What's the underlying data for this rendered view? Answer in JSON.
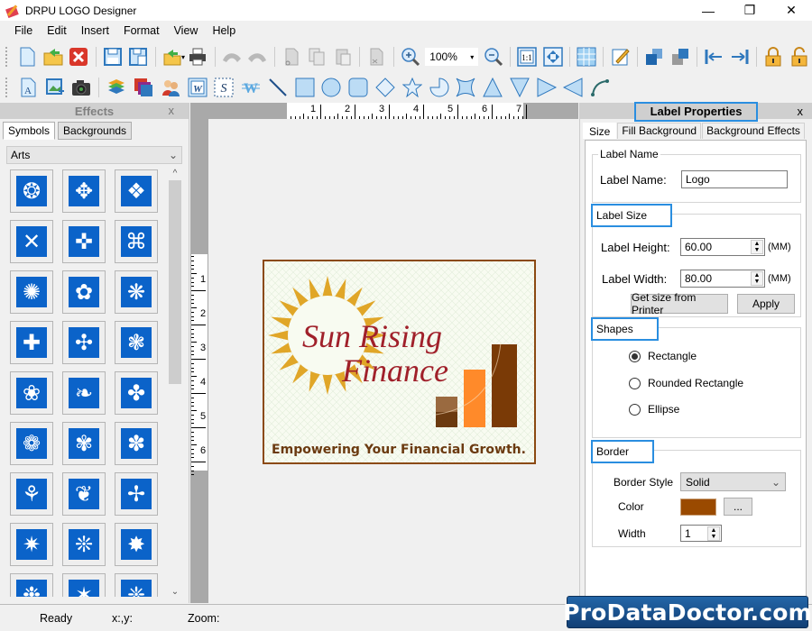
{
  "window": {
    "title": "DRPU LOGO Designer",
    "minimize": "—",
    "restore": "❐",
    "close": "✕"
  },
  "menu": [
    "File",
    "Edit",
    "Insert",
    "Format",
    "View",
    "Help"
  ],
  "toolbar": {
    "zoom_value": "100%",
    "zoom_dropdown": "▾",
    "actual_size": "1:1"
  },
  "effects_panel": {
    "title": "Effects",
    "close": "x",
    "tabs": [
      "Symbols",
      "Backgrounds"
    ],
    "category": "Arts",
    "category_arrow": "⌄",
    "symbol_count_visible": 27,
    "scroll_up": "^",
    "scroll_down": "⌄"
  },
  "canvas": {
    "h_ruler_labels": [
      "1",
      "2",
      "3",
      "4",
      "5",
      "6",
      "7"
    ],
    "v_ruler_labels": [
      "1",
      "2",
      "3",
      "4",
      "5",
      "6"
    ],
    "logo": {
      "title_line1": "Sun Rising",
      "title_line2": "Finance",
      "tagline": "Empowering Your Financial Growth.",
      "border_color": "#8b4a12",
      "title_color": "#a0202a",
      "sun_color": "#e0a628",
      "bar_colors": [
        "#8d5a2b",
        "#ff8a2a",
        "#7a3a06"
      ]
    }
  },
  "label_properties": {
    "title": "Label Properties",
    "close": "x",
    "tabs": [
      "Size",
      "Fill Background",
      "Background Effects"
    ],
    "label_name_group": "Label Name",
    "label_name_caption": "Label Name:",
    "label_name_value": "Logo",
    "label_size_group": "Label Size",
    "height_caption": "Label Height:",
    "height_value": "60.00",
    "width_caption": "Label Width:",
    "width_value": "80.00",
    "unit": "(MM)",
    "get_size_button": "Get size from Printer",
    "apply_button": "Apply",
    "shapes_group": "Shapes",
    "shapes": [
      {
        "label": "Rectangle",
        "selected": true
      },
      {
        "label": "Rounded Rectangle",
        "selected": false
      },
      {
        "label": "Ellipse",
        "selected": false
      }
    ],
    "border_group": "Border",
    "border_style_caption": "Border Style",
    "border_style_value": "Solid",
    "color_caption": "Color",
    "color_value": "#9a4a00",
    "color_button": "...",
    "width_caption_border": "Width",
    "border_width_value": "1"
  },
  "status": {
    "state": "Ready",
    "coords": "x:,y:",
    "zoom": "Zoom:"
  },
  "watermark": "ProDataDoctor.com"
}
